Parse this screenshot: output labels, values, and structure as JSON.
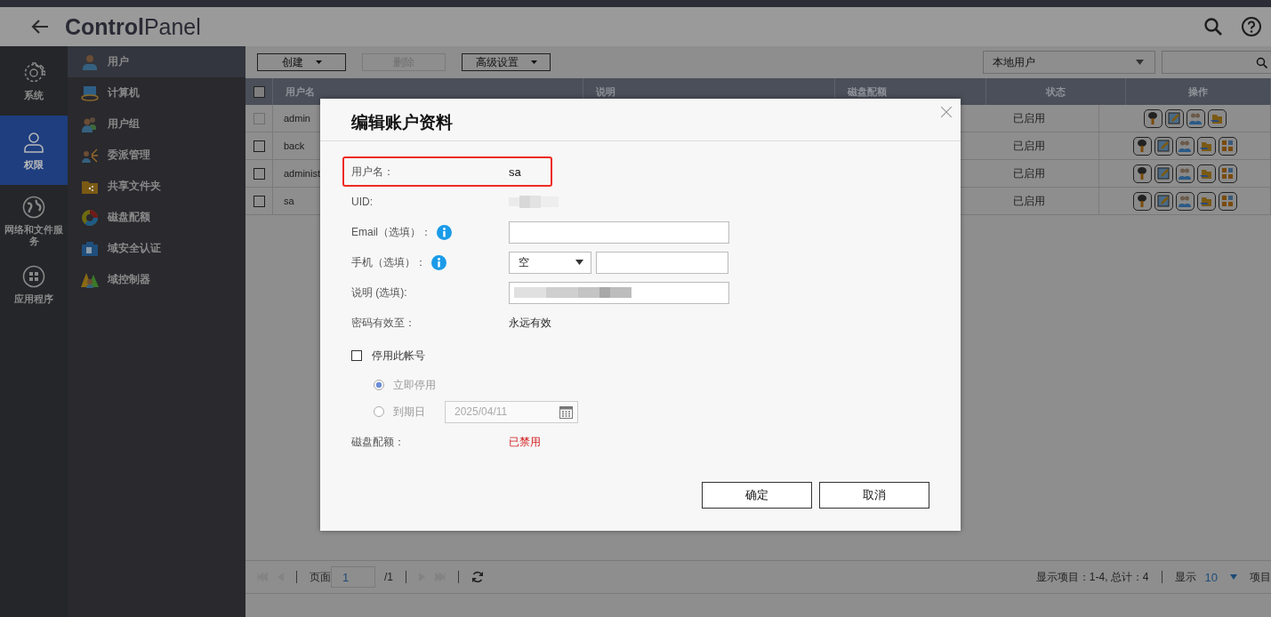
{
  "header": {
    "title": "**Control**Panel"
  },
  "nav": [
    {
      "label": "系统",
      "kind": "gear",
      "selected": false
    },
    {
      "label": "权限",
      "kind": "user",
      "selected": true
    },
    {
      "label": "网络和文件服务",
      "kind": "globe",
      "selected": false
    },
    {
      "label": "应用程序",
      "kind": "apps",
      "selected": false
    }
  ],
  "submenu": [
    {
      "label": "用户",
      "kind": "user",
      "selected": true
    },
    {
      "label": "计算机",
      "kind": "computer",
      "selected": false
    },
    {
      "label": "用户组",
      "kind": "group",
      "selected": false
    },
    {
      "label": "委派管理",
      "kind": "delegate",
      "selected": false
    },
    {
      "label": "共享文件夹",
      "kind": "folder",
      "selected": false
    },
    {
      "label": "磁盘配额",
      "kind": "donut",
      "selected": false
    },
    {
      "label": "域安全认证",
      "kind": "badge",
      "selected": false
    },
    {
      "label": "域控制器",
      "kind": "triangles",
      "selected": false
    }
  ],
  "toolbar": {
    "buttons": [
      {
        "label": "创建",
        "dropdown": true,
        "disabled": false
      },
      {
        "label": "删除",
        "dropdown": false,
        "disabled": true
      },
      {
        "label": "高级设置",
        "dropdown": true,
        "disabled": false
      }
    ],
    "filter": {
      "value": "本地用户"
    }
  },
  "table": {
    "select_all": {
      "checked": false
    },
    "columns": [
      "用户名",
      "说明",
      "磁盘配额",
      "状态",
      "操作"
    ],
    "rows": [
      {
        "name": "admin",
        "status": "已启用",
        "checkbox_disabled": true,
        "actions": [
          {
            "kind": "key"
          },
          {
            "kind": "edit"
          },
          {
            "kind": "group"
          },
          {
            "kind": "transfer"
          }
        ]
      },
      {
        "name": "back",
        "status": "已启用",
        "checkbox_disabled": false,
        "actions": [
          {
            "kind": "key"
          },
          {
            "kind": "edit"
          },
          {
            "kind": "group"
          },
          {
            "kind": "transfer"
          },
          {
            "kind": "apps"
          }
        ]
      },
      {
        "name": "administ",
        "status": "已启用",
        "checkbox_disabled": false,
        "actions": [
          {
            "kind": "key"
          },
          {
            "kind": "edit"
          },
          {
            "kind": "group"
          },
          {
            "kind": "transfer"
          },
          {
            "kind": "apps"
          }
        ]
      },
      {
        "name": "sa",
        "status": "已启用",
        "checkbox_disabled": false,
        "actions": [
          {
            "kind": "key"
          },
          {
            "kind": "edit"
          },
          {
            "kind": "group"
          },
          {
            "kind": "transfer"
          },
          {
            "kind": "apps"
          }
        ]
      }
    ]
  },
  "pager": {
    "page_label": "页面",
    "page": "1",
    "total_pages": "/1",
    "summary": "显示项目：1-4, 总计：4",
    "show_label": "显示",
    "per_page": "10",
    "items_label": "项目"
  },
  "dialog": {
    "title": "编辑账户资料",
    "fields": [
      {
        "kind": "text",
        "label": "用户名：",
        "value": "sa",
        "highlighted": true
      },
      {
        "kind": "redacted",
        "label": "UID:",
        "highlighted": false
      },
      {
        "kind": "input",
        "label": "Email（选填）：",
        "info": true,
        "highlighted": false
      },
      {
        "kind": "phone",
        "label": "手机（选填）：",
        "info": true,
        "select": "空",
        "highlighted": false
      },
      {
        "kind": "redacted-input",
        "label": "说明 (选填):",
        "highlighted": false
      },
      {
        "kind": "text",
        "label": "密码有效至：",
        "value": "永远有效",
        "highlighted": false
      }
    ],
    "disable_account": {
      "label": "停用此帐号",
      "checked": false,
      "options": [
        {
          "label": "立即停用",
          "selected": true
        },
        {
          "label": "到期日",
          "selected": false,
          "date": "2025/04/11"
        }
      ]
    },
    "quota": {
      "label": "磁盘配额：",
      "value": "已禁用"
    },
    "buttons": [
      "确定",
      "取消"
    ]
  }
}
